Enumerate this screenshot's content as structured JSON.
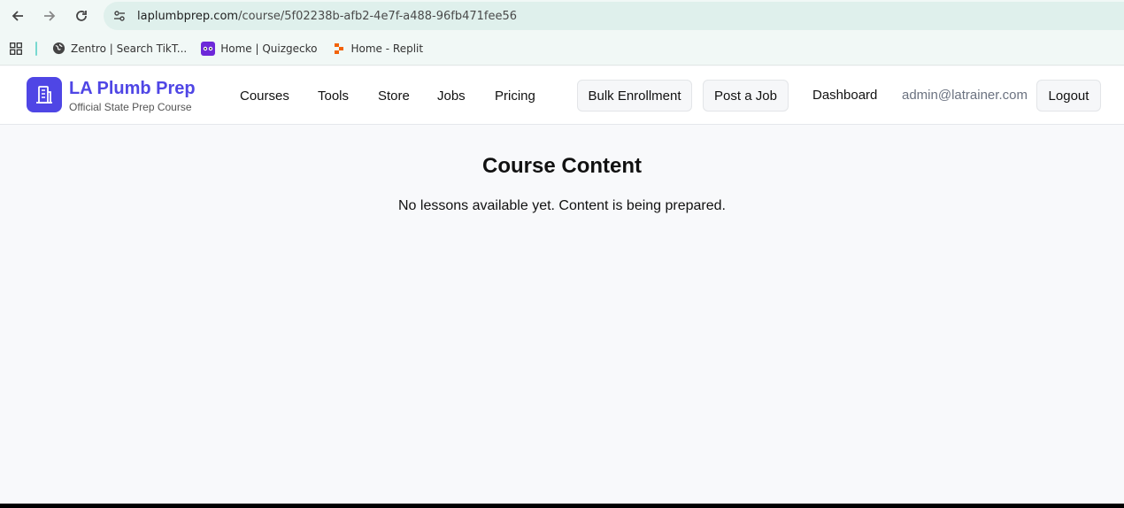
{
  "browser": {
    "url_host": "laplumbprep.com",
    "url_path": "/course/5f02238b-afb2-4e7f-a488-96fb471fee56",
    "bookmarks": [
      {
        "label": "Zentro | Search TikT...",
        "icon": "globe-icon"
      },
      {
        "label": "Home | Quizgecko",
        "icon": "quizgecko-icon"
      },
      {
        "label": "Home - Replit",
        "icon": "replit-icon"
      }
    ]
  },
  "brand": {
    "title": "LA Plumb Prep",
    "subtitle": "Official State Prep Course",
    "accent": "#4f46e5"
  },
  "nav": {
    "courses": "Courses",
    "tools": "Tools",
    "store": "Store",
    "jobs": "Jobs",
    "pricing": "Pricing"
  },
  "actions": {
    "bulk_enrollment": "Bulk Enrollment",
    "post_job": "Post a Job",
    "dashboard": "Dashboard",
    "user_email": "admin@latrainer.com",
    "logout": "Logout"
  },
  "main": {
    "title": "Course Content",
    "message": "No lessons available yet. Content is being prepared."
  }
}
